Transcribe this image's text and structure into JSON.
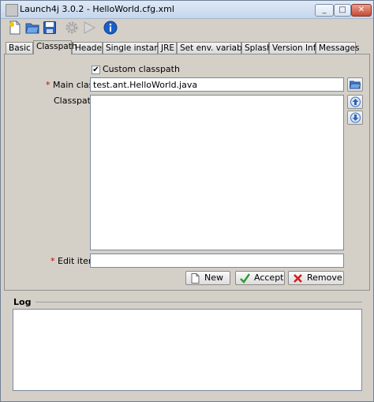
{
  "window": {
    "title": "Launch4j 3.0.2 - HelloWorld.cfg.xml",
    "minimize_glyph": "_",
    "maximize_glyph": "□",
    "close_glyph": "✕"
  },
  "toolbar": {
    "icons": [
      "new-document-icon",
      "open-folder-icon",
      "save-icon",
      "gear-icon",
      "run-icon",
      "info-icon"
    ]
  },
  "tabs": [
    "Basic",
    "Classpath",
    "Header",
    "Single instance",
    "JRE",
    "Set env. variables",
    "Splash",
    "Version Info",
    "Messages"
  ],
  "active_tab": "Classpath",
  "classpath": {
    "custom_classpath_label": "Custom classpath",
    "custom_classpath_checked": true,
    "check_glyph": "✔",
    "required_mark": "*",
    "main_class_label": "Main class:",
    "main_class_value": "test.ant.HelloWorld.java",
    "classpath_label": "Classpath:",
    "edit_item_label": "Edit item:",
    "edit_item_value": "",
    "new_label": "New",
    "accept_label": "Accept",
    "remove_label": "Remove"
  },
  "log": {
    "title": "Log",
    "content": ""
  },
  "colors": {
    "required": "#cc0000",
    "accept_green": "#2e9a2e",
    "remove_red": "#d42020",
    "info_blue": "#1a5fc8"
  }
}
